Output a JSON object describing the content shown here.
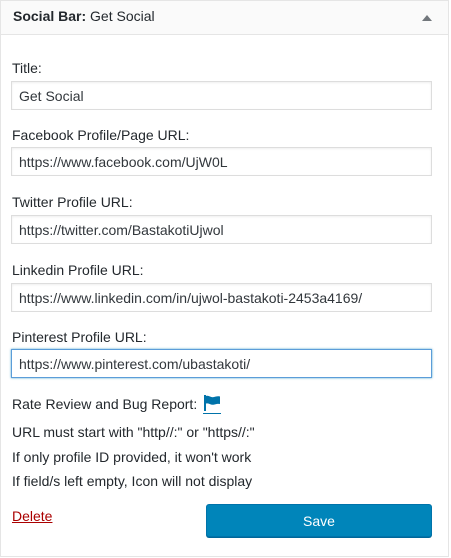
{
  "widget": {
    "title_prefix": "Social Bar",
    "title_separator": ":",
    "title_name": "Get Social"
  },
  "fields": {
    "title": {
      "label": "Title:",
      "value": "Get Social"
    },
    "facebook": {
      "label": "Facebook Profile/Page URL:",
      "value": "https://www.facebook.com/UjW0L"
    },
    "twitter": {
      "label": "Twitter Profile URL:",
      "value": "https://twitter.com/BastakotiUjwol"
    },
    "linkedin": {
      "label": "Linkedin Profile URL:",
      "value": "https://www.linkedin.com/in/ujwol-bastakoti-2453a4169/"
    },
    "pinterest": {
      "label": "Pinterest Profile URL:",
      "value": "https://www.pinterest.com/ubastakoti/"
    }
  },
  "notes": {
    "rate_review": "Rate Review and Bug Report:",
    "line1": "URL must start with \"http//:\" or \"https//:\"",
    "line2": "If only profile ID provided, it won't work",
    "line3": "If field/s left empty, Icon will not display"
  },
  "actions": {
    "delete_label": "Delete",
    "save_label": "Save"
  },
  "icons": {
    "toggle": "arrow-up-icon",
    "report": "flag-icon"
  },
  "colors": {
    "primary_button": "#0085ba",
    "flag": "#0073aa",
    "delete": "#aa0000",
    "focus_border": "#5b9dd9"
  }
}
